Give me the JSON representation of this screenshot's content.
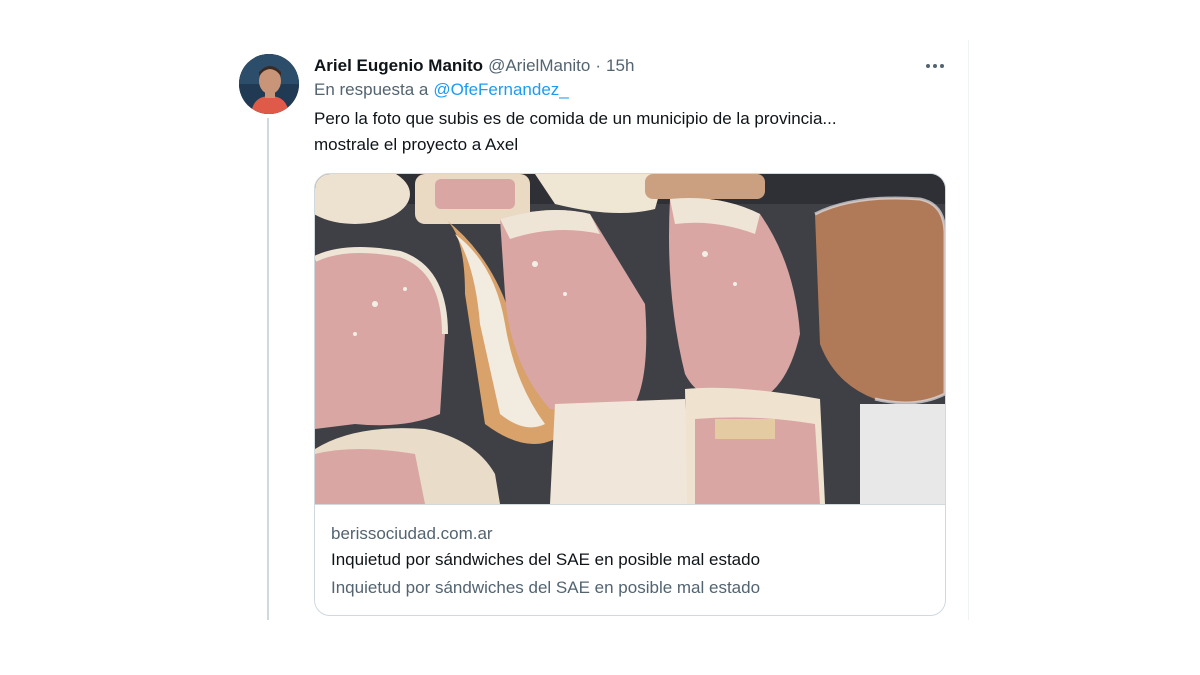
{
  "tweet": {
    "author": {
      "name": "Ariel Eugenio Manito",
      "handle": "@ArielManito",
      "separator": "·",
      "time": "15h"
    },
    "reply_to": {
      "prefix": "En respuesta a",
      "mention": "@OfeFernandez_"
    },
    "text_lines": [
      "Pero la foto que subis es de comida de un municipio de la provincia...",
      "mostrale el proyecto a Axel"
    ],
    "more_icon": "more-horizontal-icon",
    "card": {
      "image_subject": "sandwiches-photo",
      "domain": "berissociudad.com.ar",
      "title": "Inquietud por sándwiches del SAE en posible mal estado",
      "description": "Inquietud por sándwiches del SAE en posible mal estado"
    }
  },
  "colors": {
    "text_primary": "#0f1419",
    "text_secondary": "#536471",
    "link": "#1d9bf0",
    "border": "#cfd9de"
  }
}
